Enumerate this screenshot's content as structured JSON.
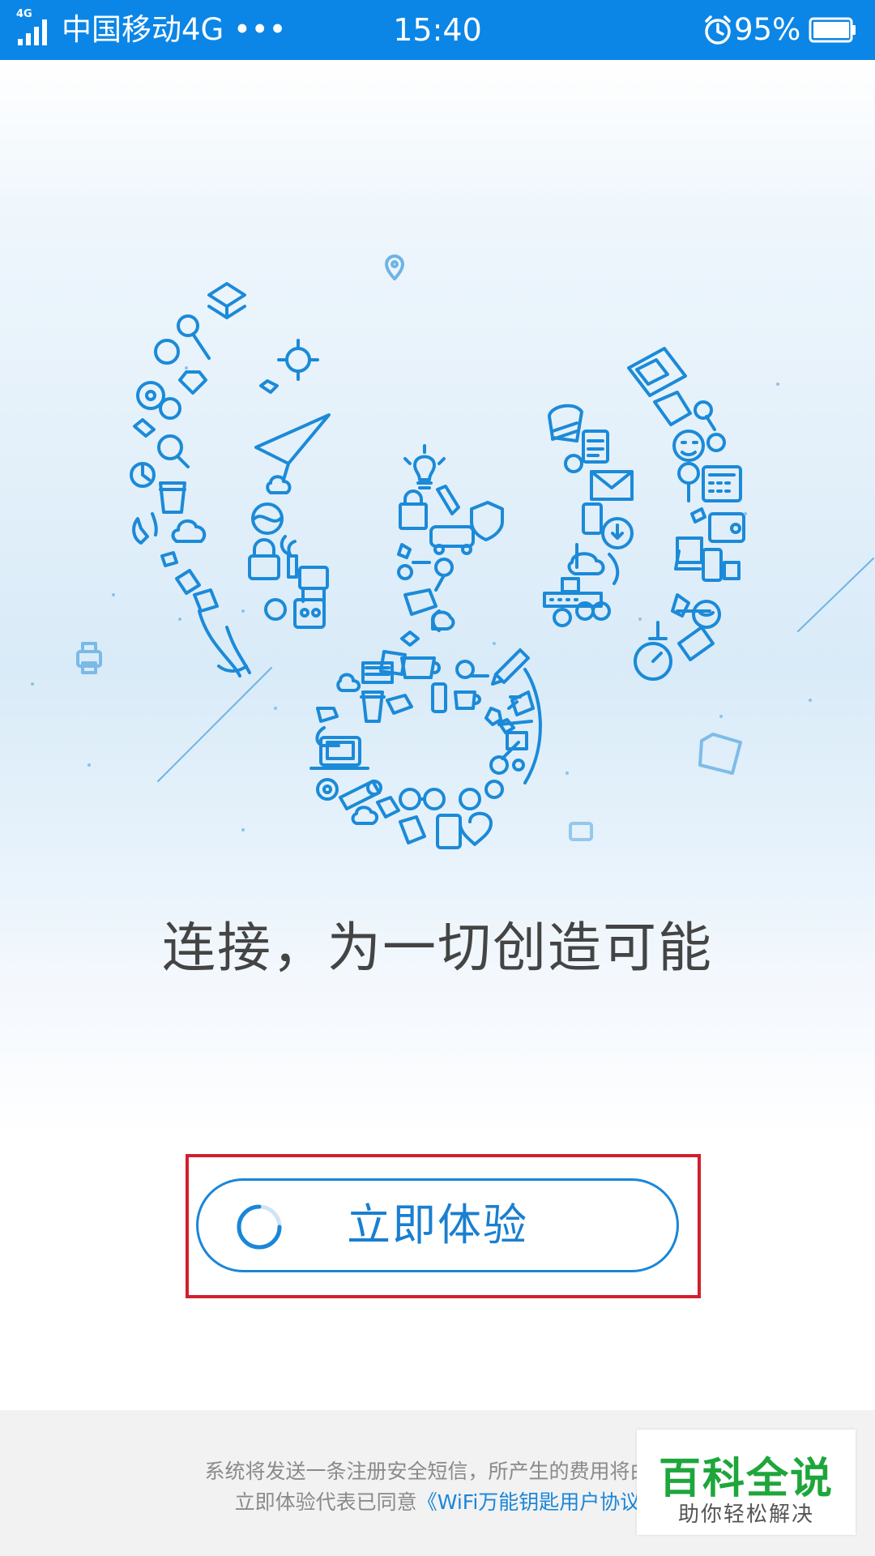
{
  "status_bar": {
    "network_type": "4G",
    "carrier": "中国移动4G •••",
    "time": "15:40",
    "battery_percent": "95%",
    "icons": [
      "signal-icon",
      "alarm-icon",
      "battery-icon"
    ]
  },
  "hero": {
    "slogan": "连接，为一切创造可能"
  },
  "cta": {
    "label": "立即体验",
    "loading": true
  },
  "footer": {
    "line1": "系统将发送一条注册安全短信，所产生的费用将由运",
    "line2_prefix": "立即体验代表已同意",
    "agreement_link": "《WiFi万能钥匙用户协议"
  },
  "watermark": {
    "title": "百科全说",
    "subtitle": "助你轻松解决"
  },
  "colors": {
    "status_bar": "#0b86e6",
    "accent": "#1a86d8",
    "highlight_border": "#d21f2b",
    "watermark_green": "#1ea63a"
  }
}
